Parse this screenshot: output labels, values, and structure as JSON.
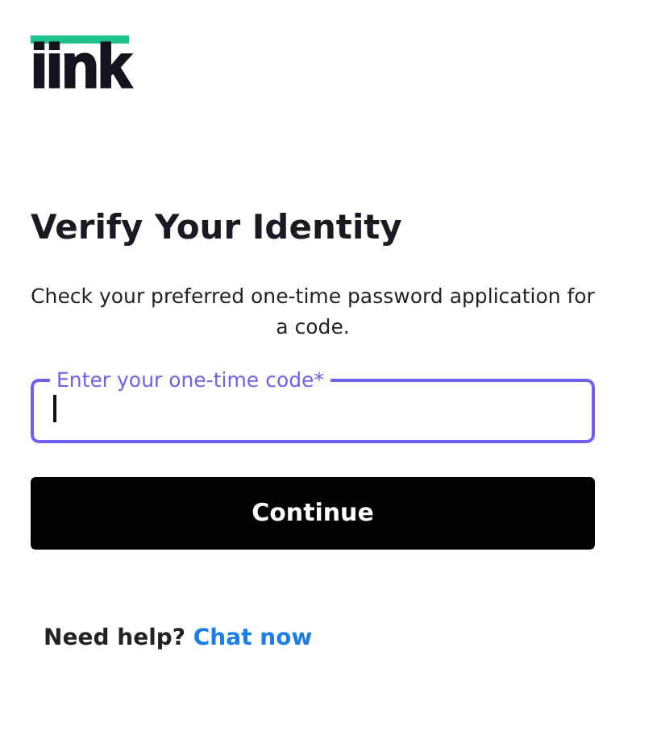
{
  "logo": {
    "text": "iink"
  },
  "title": "Verify Your Identity",
  "description": "Check your preferred one-time password application for a code.",
  "code_field": {
    "label": "Enter your one-time code*",
    "focused": true
  },
  "continue_button": {
    "label": "Continue"
  },
  "help": {
    "text": "Need help?",
    "link": "Chat now"
  }
}
